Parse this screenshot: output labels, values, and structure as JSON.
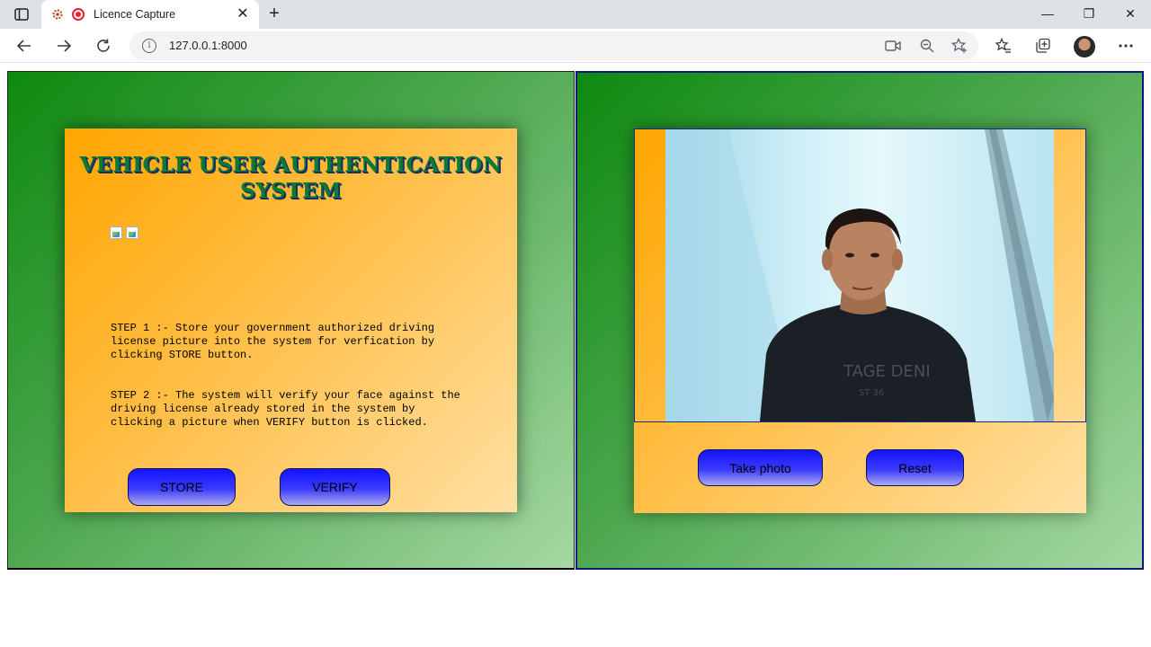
{
  "browser": {
    "tab_title": "Licence Capture",
    "tab_close": "✕",
    "new_tab": "+",
    "url": "127.0.0.1:8000",
    "window": {
      "minimize": "—",
      "restore": "❐",
      "close": "✕"
    }
  },
  "left_card": {
    "title": "VEHICLE USER AUTHENTICATION SYSTEM",
    "step1": "STEP 1 :- Store your government authorized driving license picture into the system for verfication by clicking STORE button.",
    "step2": "STEP 2 :- The system will verify your face against the driving license already stored in the system by clicking a picture when VERIFY button is clicked.",
    "store_label": "STORE",
    "verify_label": "VERIFY"
  },
  "camera": {
    "take_photo_label": "Take photo",
    "reset_label": "Reset"
  },
  "colors": {
    "panel_green": "#0e8a10",
    "card_orange": "#ffa600",
    "button_blue": "#1313ff",
    "title_green": "#0b7a32"
  },
  "icons": {
    "tab_actions": "tab-actions-icon",
    "favicon": "settings-favicon-icon",
    "recording": "recording-icon",
    "back": "back-arrow-icon",
    "forward": "forward-arrow-icon",
    "refresh": "refresh-icon",
    "site_info": "info-icon",
    "camera_indicator": "camera-icon",
    "zoom": "zoom-out-icon",
    "add_favorite": "add-favorite-icon",
    "favorites": "favorites-icon",
    "collections": "collections-icon",
    "more": "more-icon"
  }
}
